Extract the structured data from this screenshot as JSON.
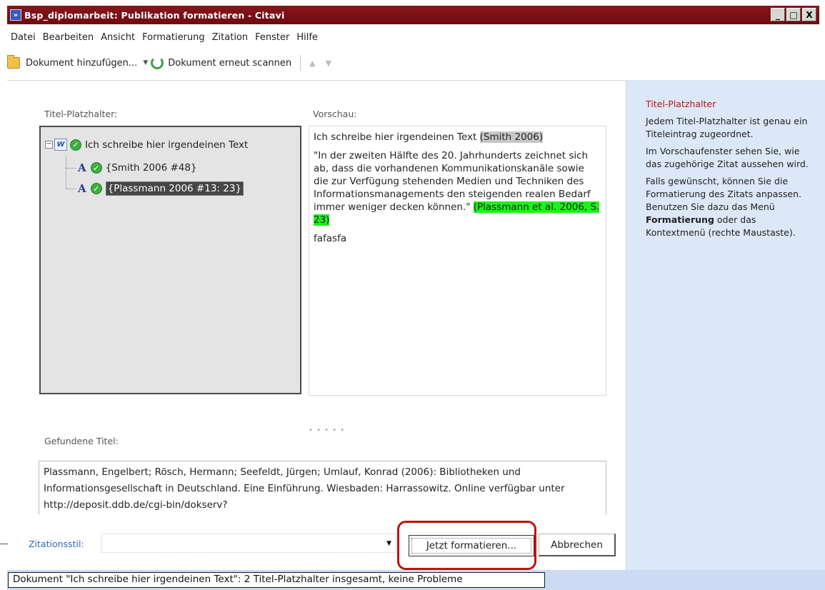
{
  "window": {
    "title": "Bsp_diplomarbeit: Publikation formatieren - Citavi",
    "buttons": [
      "_",
      "□",
      "X"
    ]
  },
  "menu": [
    "Datei",
    "Bearbeiten",
    "Ansicht",
    "Formatierung",
    "Zitation",
    "Fenster",
    "Hilfe"
  ],
  "toolbar": {
    "add_document": "Dokument hinzufügen...",
    "rescan_document": "Dokument erneut scannen",
    "icons": [
      "folder-icon",
      "refresh-icon",
      "move-up-icon",
      "move-down-icon"
    ]
  },
  "placeholders": {
    "label": "Titel-Platzhalter:",
    "root": "Ich schreibe hier irgendeinen  Text",
    "items": [
      "{Smith 2006 #48}",
      "{Plassmann 2006 #13: 23}"
    ]
  },
  "preview": {
    "label": "Vorschau:",
    "line1_text": "Ich schreibe hier irgendeinen  Text ",
    "line1_citation": "(Smith 2006)",
    "quote_text": "\"In der zweiten Hälfte des 20. Jahrhunderts zeichnet sich ab, dass die vorhandenen Kommunikationskanäle sowie die zur Verfügung stehenden Medien und Techniken des Informationsmanagements den steigenden realen Bedarf immer weniger decken können.\" ",
    "quote_citation": "(Plassmann et al. 2006, S. 23)",
    "extra": "fafasfa"
  },
  "found": {
    "label": "Gefundene Titel:",
    "text": "Plassmann, Engelbert; Rösch, Hermann; Seefeldt, Jürgen; Umlauf, Konrad (2006): Bibliotheken und Informationsgesellschaft in Deutschland. Eine Einführung. Wiesbaden: Harrassowitz. Online verfügbar unter http://deposit.ddb.de/cgi-bin/dokserv?"
  },
  "citation_style": {
    "label": "Zitationsstil:",
    "value": ""
  },
  "buttons": {
    "format": "Jetzt formatieren...",
    "cancel": "Abbrechen"
  },
  "help": {
    "title": "Titel-Platzhalter",
    "p1": "Jedem Titel-Platzhalter ist genau ein Titeleintrag zugeordnet.",
    "p2": "Im Vorschaufenster sehen Sie, wie das zugehörige Zitat aussehen wird.",
    "p3_before": "Falls gewünscht, können Sie die Formatierung des Zitats anpassen. Benutzen Sie dazu das Menü ",
    "p3_bold": "Formatierung",
    "p3_after": " oder das Kontextmenü (rechte Maustaste)."
  },
  "status": {
    "text": "Dokument \"Ich schreibe hier irgendeinen  Text\": 2 Titel-Platzhalter insgesamt, keine Probleme"
  },
  "colors": {
    "titlebar": "#7a1016",
    "help_title": "#c0140e",
    "highlight_green": "#1ef01e",
    "highlight_gray": "#c8c8c8",
    "accent_blue": "#3366bb"
  }
}
